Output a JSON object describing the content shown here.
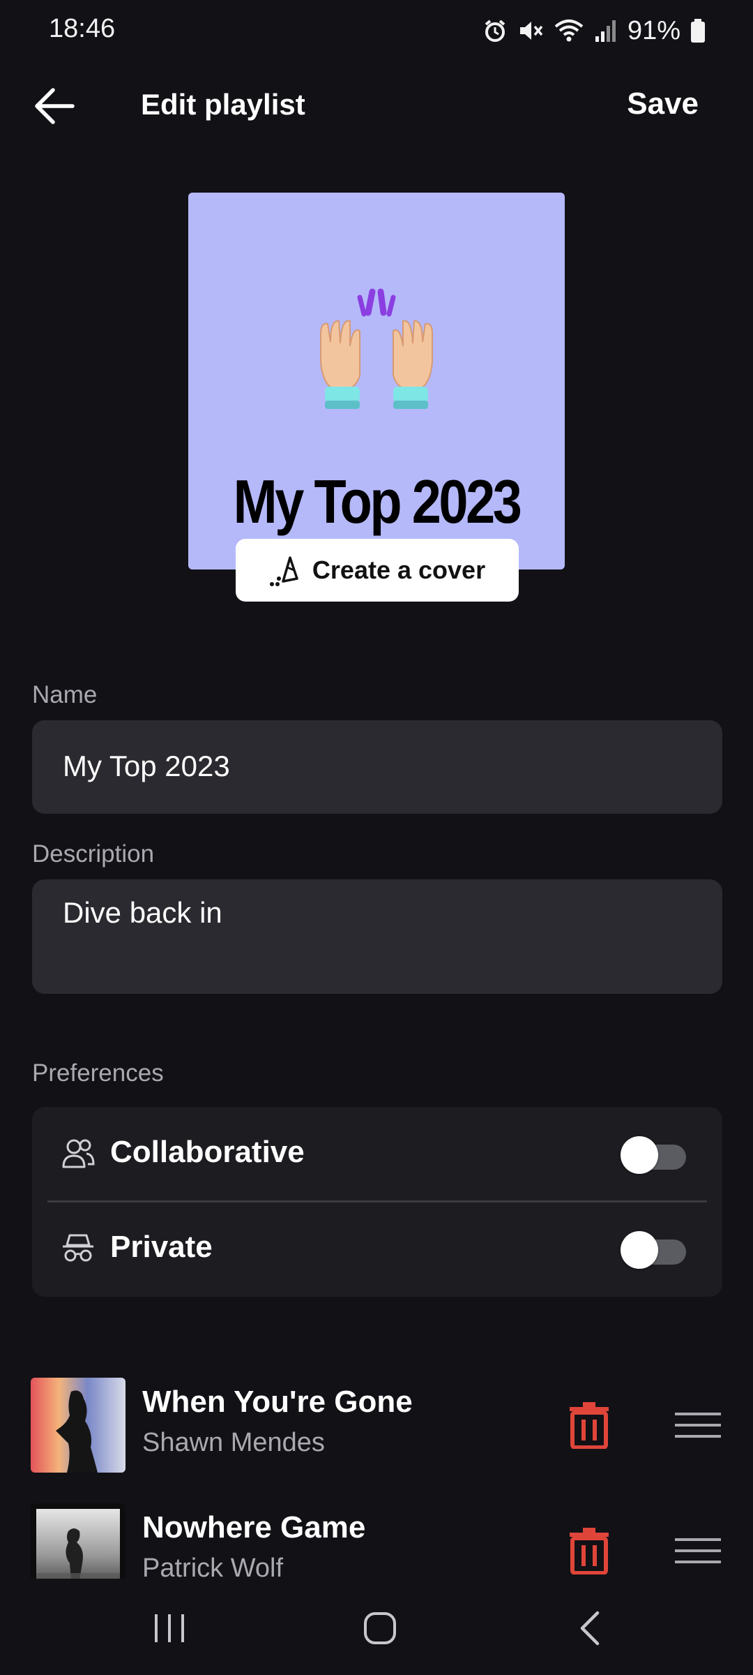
{
  "status_bar": {
    "time": "18:46",
    "battery": "91%",
    "icons": [
      "alarm-icon",
      "mute-icon",
      "wifi-icon",
      "signal-icon",
      "battery-icon"
    ]
  },
  "app_bar": {
    "title": "Edit playlist",
    "save_label": "Save"
  },
  "cover": {
    "title": "My Top 2023",
    "background": "#b5b9fa",
    "create_cover_label": "Create a cover"
  },
  "form": {
    "name_label": "Name",
    "name_value": "My Top 2023",
    "description_label": "Description",
    "description_value": "Dive back in"
  },
  "preferences": {
    "label": "Preferences",
    "collaborative": {
      "label": "Collaborative",
      "on": false
    },
    "private": {
      "label": "Private",
      "on": false
    }
  },
  "tracks": [
    {
      "title": "When You're Gone",
      "artist": "Shawn Mendes"
    },
    {
      "title": "Nowhere Game",
      "artist": "Patrick Wolf"
    }
  ],
  "colors": {
    "background": "#121116",
    "field": "#2a2a30",
    "card": "#1c1c21",
    "delete_red": "#e0453a"
  }
}
